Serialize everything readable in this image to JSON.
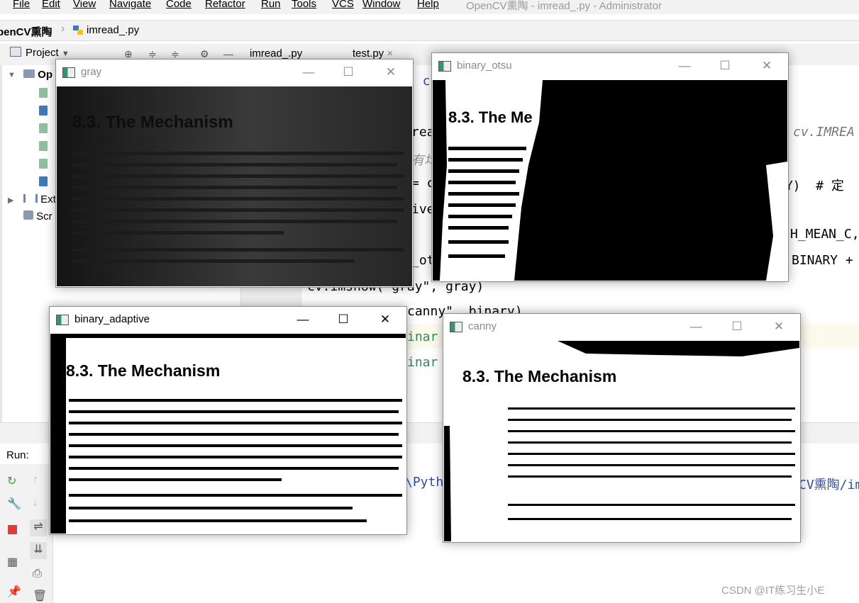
{
  "menu": {
    "items": [
      "File",
      "Edit",
      "View",
      "Navigate",
      "Code",
      "Refactor",
      "Run",
      "Tools",
      "VCS",
      "Window",
      "Help"
    ],
    "window_title": "OpenCV熏陶 - imread_.py - Administrator"
  },
  "breadcrumb": {
    "project": "penCV熏陶",
    "file": "imread_.py"
  },
  "project_panel": {
    "tab_label": "Project",
    "root": "Op",
    "external": "Ext",
    "scratches": "Scr"
  },
  "editor_tabs": [
    "imread_.py",
    "test.py"
  ],
  "code": {
    "l1": "s c",
    "l2": "rea",
    "l2_right": "cv.IMREA",
    "l3": "有均",
    "l4": "= c",
    "l4_right": "RY)  # 定",
    "l5": "ive",
    "l6_right": "H_MEAN_C,",
    "l7": "_ot",
    "l7_right": "BINARY +",
    "l8": "cv.imshow(\"gray\", gray)",
    "l9": "canny\", binary)",
    "l10": "inar",
    "l11": "inar"
  },
  "run_panel": {
    "label": "Run:",
    "output_left": "\\Pyth",
    "output_right": "CV熏陶/im"
  },
  "cv_windows": {
    "gray": {
      "title": "gray",
      "heading": "8.3. The Mechanism"
    },
    "binary_otsu": {
      "title": "binary_otsu",
      "heading": "8.3. The Me"
    },
    "binary_adaptive": {
      "title": "binary_adaptive",
      "heading": "8.3. The Mechanism"
    },
    "canny": {
      "title": "canny",
      "heading": "8.3. The Mechanism"
    }
  },
  "watermark": "CSDN @IT练习生小E",
  "colors": {
    "accent": "#2e4fa3",
    "run_green": "#3c9a3c",
    "stop_red": "#e53935"
  }
}
